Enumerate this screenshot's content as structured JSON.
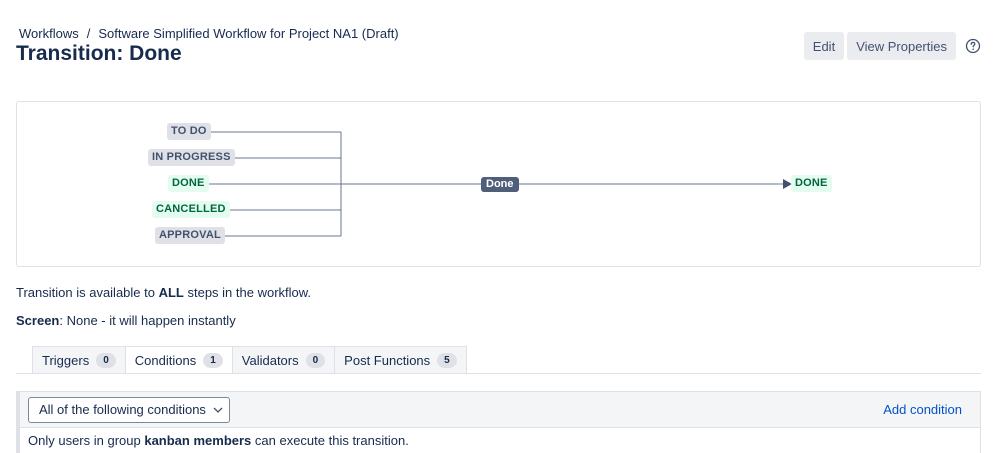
{
  "breadcrumb": {
    "root": "Workflows",
    "separator": "/",
    "current": "Software Simplified Workflow for Project NA1 (Draft)"
  },
  "page_title": "Transition: Done",
  "actions": {
    "edit": "Edit",
    "view_properties": "View Properties",
    "help_icon": "question-circle-icon"
  },
  "diagram": {
    "source_statuses": [
      "TO DO",
      "IN PROGRESS",
      "DONE",
      "CANCELLED",
      "APPROVAL"
    ],
    "transition_label": "Done",
    "target_status": "DONE"
  },
  "info": {
    "availability_prefix": "Transition is available to ",
    "availability_bold": "ALL",
    "availability_suffix": " steps in the workflow.",
    "screen_label": "Screen",
    "screen_value": ": None - it will happen instantly"
  },
  "tabs": [
    {
      "label": "Triggers",
      "count": "0"
    },
    {
      "label": "Conditions",
      "count": "1"
    },
    {
      "label": "Validators",
      "count": "0"
    },
    {
      "label": "Post Functions",
      "count": "5"
    }
  ],
  "conditions": {
    "select_value": "All of the following conditions",
    "add_label": "Add condition",
    "rule_prefix": "Only users in group ",
    "rule_group": "kanban members",
    "rule_suffix": " can execute this transition."
  },
  "colors": {
    "link": "#0052cc",
    "text": "#172b4d",
    "lozenge": "#505f79",
    "done_status_bg": "#e3fcef"
  }
}
